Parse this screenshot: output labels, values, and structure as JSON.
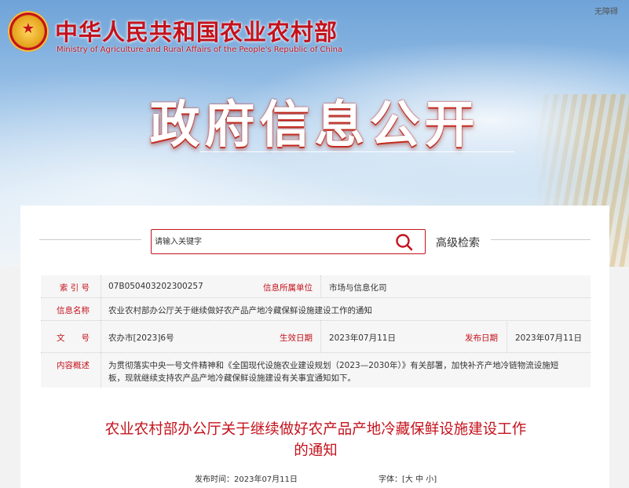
{
  "header": {
    "no_barrier": "无障碍",
    "ministry_cn": "中华人民共和国农业农村部",
    "ministry_en": "Ministry of Agriculture and Rural Affairs of the People's Republic of China",
    "title": "政府信息公开"
  },
  "search": {
    "placeholder": "请输入关键字",
    "advanced": "高级检索"
  },
  "meta": {
    "index_label": "索 引 号",
    "index_value": "07B050403202300257",
    "unit_label": "信息所属单位",
    "unit_value": "市场与信息化司",
    "name_label": "信息名称",
    "name_value": "农业农村部办公厅关于继续做好农产品产地冷藏保鲜设施建设工作的通知",
    "doc_label": "文　　号",
    "doc_value": "农办市[2023]6号",
    "effective_label": "生效日期",
    "effective_value": "2023年07月11日",
    "publish_label": "发布日期",
    "publish_value": "2023年07月11日",
    "summary_label": "内容概述",
    "summary_line1": "为贯彻落实中央一号文件精神和《全国现代设施农业建设规划（2023—2030年）》有关部署，加快补齐产地冷链物流设施短",
    "summary_line2": "板，现就继续支持农产品产地冷藏保鲜设施建设有关事宜通知如下。"
  },
  "doc": {
    "title_line1": "农业农村部办公厅关于继续做好农产品产地冷藏保鲜设施建设工作",
    "title_line2": "的通知",
    "publish_time": "发布时间：2023年07月11日",
    "font_size": "字体：[大 中 小]"
  },
  "colors": {
    "accent": "#c4121c",
    "meta_bg": "#f6f6f6"
  },
  "icons": {
    "search": "search-icon",
    "emblem": "national-emblem-icon"
  }
}
